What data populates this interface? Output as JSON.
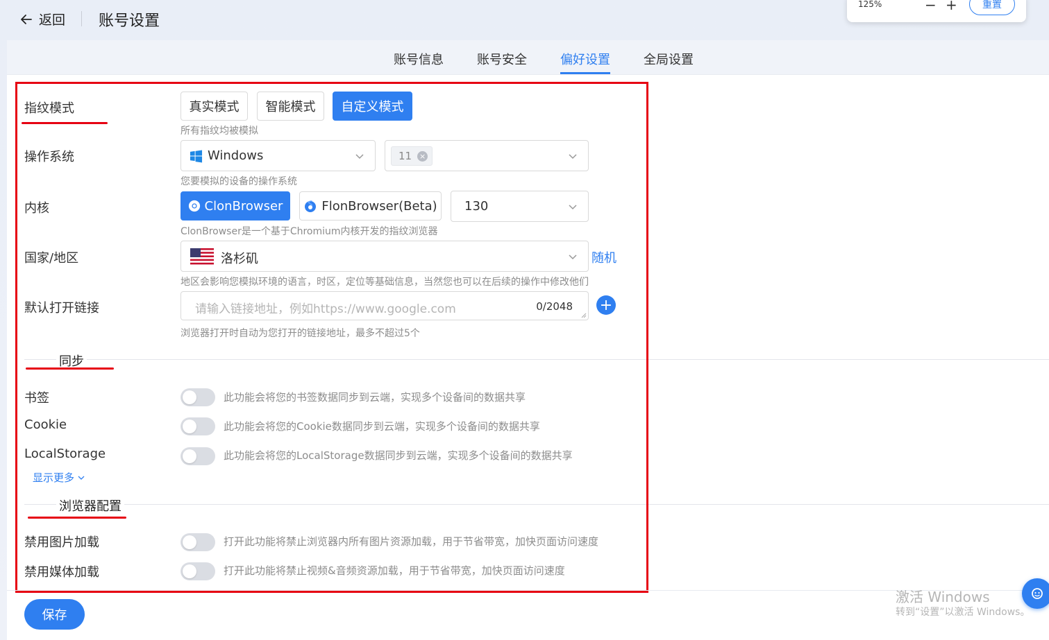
{
  "header": {
    "back_label": "返回",
    "page_title": "账号设置"
  },
  "zoom": {
    "level": "125%",
    "minus": "−",
    "plus": "+",
    "reset_label": "重置"
  },
  "tabs": [
    {
      "label": "账号信息",
      "active": false
    },
    {
      "label": "账号安全",
      "active": false
    },
    {
      "label": "偏好设置",
      "active": true
    },
    {
      "label": "全局设置",
      "active": false
    }
  ],
  "fingerprint": {
    "label": "指纹模式",
    "modes": [
      "真实模式",
      "智能模式",
      "自定义模式"
    ],
    "selected": "自定义模式",
    "hint": "所有指纹均被模拟"
  },
  "os": {
    "label": "操作系统",
    "selected": "Windows",
    "version_tag": "11",
    "hint": "您要模拟的设备的操作系统"
  },
  "kernel": {
    "label": "内核",
    "options": [
      "ClonBrowser",
      "FlonBrowser(Beta)"
    ],
    "selected": "ClonBrowser",
    "version": "130",
    "hint": "ClonBrowser是一个基于Chromium内核开发的指纹浏览器"
  },
  "region": {
    "label": "国家/地区",
    "selected": "洛杉矶",
    "random_label": "随机",
    "hint": "地区会影响您模拟环境的语言，时区，定位等基础信息，当然您也可以在后续的操作中修改他们"
  },
  "default_link": {
    "label": "默认打开链接",
    "placeholder": "请输入链接地址，例如https://www.google.com",
    "counter": "0/2048",
    "hint": "浏览器打开时自动为您打开的链接地址，最多不超过5个"
  },
  "sync": {
    "title": "同步",
    "items": [
      {
        "label": "书签",
        "desc": "此功能会将您的书签数据同步到云端，实现多个设备间的数据共享",
        "enabled": false
      },
      {
        "label": "Cookie",
        "desc": "此功能会将您的Cookie数据同步到云端，实现多个设备间的数据共享",
        "enabled": false
      },
      {
        "label": "LocalStorage",
        "desc": "此功能会将您的LocalStorage数据同步到云端，实现多个设备间的数据共享",
        "enabled": false
      }
    ],
    "show_more": "显示更多"
  },
  "browser_config": {
    "title": "浏览器配置",
    "items": [
      {
        "label": "禁用图片加载",
        "desc": "打开此功能将禁止浏览器内所有图片资源加载，用于节省带宽，加快页面访问速度",
        "enabled": false
      },
      {
        "label": "禁用媒体加载",
        "desc": "打开此功能将禁止视频&音频资源加载，用于节省带宽，加快页面访问速度",
        "enabled": false
      }
    ]
  },
  "save_label": "保存",
  "watermark": {
    "line1": "激活 Windows",
    "line2": "转到“设置”以激活 Windows。"
  },
  "colors": {
    "accent": "#2f7ff0",
    "annotation_red": "#e60012"
  }
}
